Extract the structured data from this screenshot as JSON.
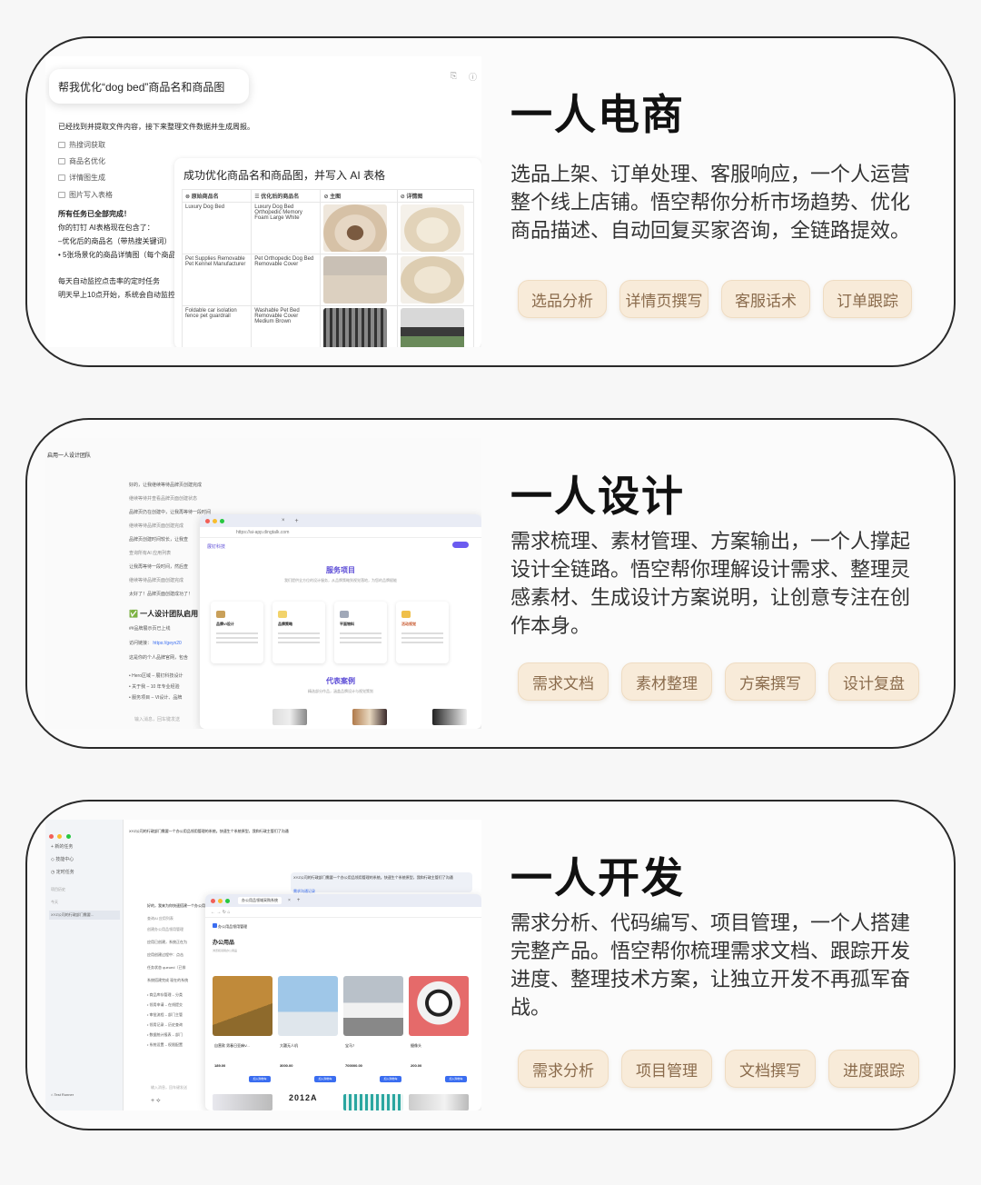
{
  "cards": {
    "ecommerce": {
      "title": "一人电商",
      "description": "选品上架、订单处理、客服响应，一个人运营整个线上店铺。悟空帮你分析市场趋势、优化商品描述、自动回复买家咨询，全链路提效。",
      "tags": [
        "选品分析",
        "详情页撰写",
        "客服话术",
        "订单跟踪"
      ],
      "screenshot": {
        "prompt_bubble": "帮我优化“dog bed”商品名和商品图",
        "status_line": "已经找到并提取文件内容，接下来整理文件数据并生成周报。",
        "steps": [
          "热搜词获取",
          "商品名优化",
          "详情图生成",
          "图片写入表格"
        ],
        "done_title": "所有任务已全部完成！",
        "done_line1": "你的钉钉 AI表格现在包含了：",
        "done_line2": "–优化后的商品名（带热搜关键词）",
        "done_line3": "• 5张场景化的商品详情图（每个商品",
        "monitor_line1": "每天自动监控点击率的定时任务",
        "monitor_line2": "明天早上10点开始，系统会自动监控",
        "panel_title": "成功优化商品名和商品图，并写入 AI 表格",
        "columns": [
          "原始商品名",
          "优化后的商品名",
          "主图",
          "详情图"
        ],
        "rows": [
          {
            "original": "Luxury Dog Bed",
            "optimized": "Luxury Dog Bed Orthopedic Memory Foam Large White"
          },
          {
            "original": "Pet Supplies Removable Pet Kennel Manufacturer",
            "optimized": "Pet Orthopedic Dog Bed Removable Cover"
          },
          {
            "original": "Foldable car isolation fence pet guardrail",
            "optimized": "Washable Pet Bed Removable Cover Medium Brown"
          }
        ]
      }
    },
    "design": {
      "title": "一人设计",
      "description": "需求梳理、素材管理、方案输出，一个人撑起设计全链路。悟空帮你理解设计需求、整理灵感素材、生成设计方案说明，让创意专注在创作本身。",
      "tags": [
        "需求文档",
        "素材整理",
        "方案撰写",
        "设计复盘"
      ],
      "screenshot": {
        "header": "启用一人设计团队",
        "chat_lines": [
          "好的，让我继续等待品牌页创建完成",
          "继续等待并查看品牌页面创建状态",
          "品牌页仍在创建中，让我再等待一段时间",
          "继续等待品牌页面创建完成",
          "品牌页创建时间较长，让我查",
          "查询所有AI 应用列表",
          "让我再等待一段时间，然后查",
          "继续等待品牌页面创建完成",
          "太好了！品牌页面创建成功了！"
        ],
        "success_title": "✅ 一人设计团队启用",
        "published": "##品牌展示页已上线",
        "link_label": "访问链接：",
        "link_url": "https://geyn20",
        "includes": "这是你的个人品牌官网，包含",
        "bullets": [
          "Hero区域 – 展钉科技设计",
          "关于我 – 10 年专业经验",
          "服务项目 – VI设计、品牌"
        ],
        "input_placeholder": "输入消息，回车键发送",
        "url": "https://ai-app.dingtalk.com",
        "brand": "展钉科技",
        "section_services": "服务项目",
        "section_services_sub": "我们提供全方位的设计服务，从品牌策略到视觉落地，为您的品牌赋能",
        "services": [
          "品牌VI设计",
          "品牌策略",
          "平面物料",
          "活动视觉"
        ],
        "section_cases": "代表案例",
        "section_cases_sub": "精选部分作品，涵盖品牌设计与视觉策划"
      }
    },
    "dev": {
      "title": "一人开发",
      "description": "需求分析、代码编写、项目管理，一个人搭建完整产品。悟空帮你梳理需求文档、跟踪开发进度、整理技术方案，让独立开发不再孤军奋战。",
      "tags": [
        "需求分析",
        "项目管理",
        "文档撰写",
        "进度跟踪"
      ],
      "screenshot": {
        "top_line": "XYZ公司的行政部门需要一个办公用品领用管理的系统。快速生个系统原型，我和行政主管们了沟通",
        "sidebar_items": [
          "新的任务",
          "技能中心",
          "定时任务"
        ],
        "sidebar_label": "项目历史",
        "sidebar_today": "今天",
        "sidebar_task": "XYZ公司的行政部门需要...",
        "sidebar_footer": "Test Runner",
        "bubble_text": "XYZ公司的行政部门需要一个办公用品领用管理的系统。快速生个系统原型，我和行政主管们了沟通",
        "bubble_link": "需求沟通记录",
        "chat_lines": [
          "好的，我来为你快速搭建一个办公用品领用管理系统原型。",
          "查询AI 应用列表",
          "创建办公用品领用管理",
          "应用已创建，系统正在为",
          "应用创建过程中：点击",
          "任务状态 queued（已排",
          "系统搭建完成 现在的系统"
        ],
        "bullets": [
          "商品库存管理 – 分类",
          "领用申请 – 在线提交",
          "审批流程 – 部门主管",
          "领用记录 – 历史查询",
          "数据统计报表 – 部门",
          "系统设置 – 权限配置"
        ],
        "tab_title": "办公用品领域采购系统",
        "app_name": "办公用品领用管理",
        "page_title": "办公用品",
        "page_sub": "浏览和领用办公用品",
        "products": [
          {
            "name": "自营款 男春日亚麻V...",
            "price": "189.00"
          },
          {
            "name": "大疆无人机",
            "price": "3000.00"
          },
          {
            "name": "宝马7",
            "price": "700000.00"
          },
          {
            "name": "摄像头",
            "price": "200.00"
          }
        ],
        "cart_label": "加入购物车",
        "bottom_text": "2012A",
        "input_placeholder": "输入消息，回车键发送"
      }
    }
  }
}
